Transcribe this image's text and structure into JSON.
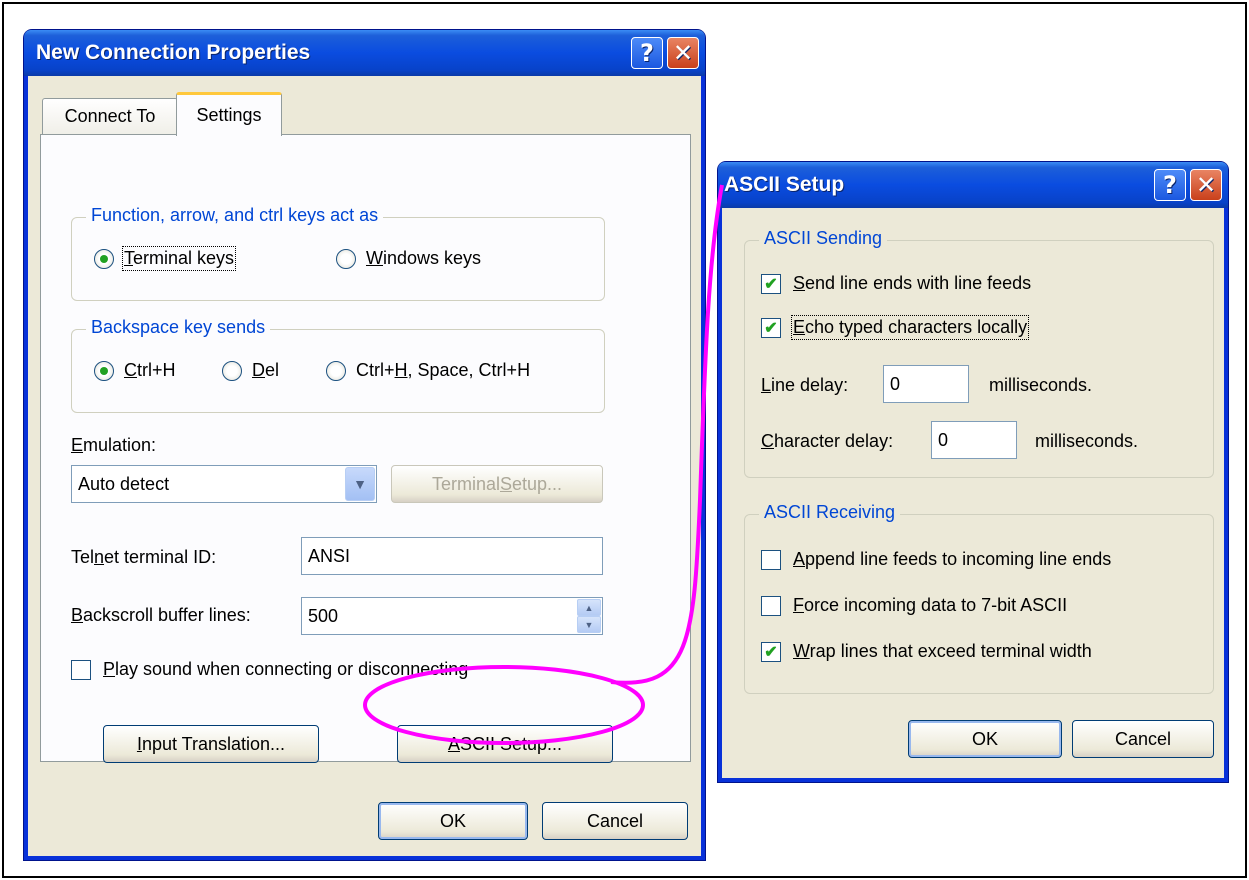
{
  "main_dialog": {
    "title": "New Connection Properties",
    "tabs": [
      {
        "label": "Connect To"
      },
      {
        "label": "Settings"
      }
    ],
    "function_keys_group": {
      "legend": "Function, arrow, and ctrl keys act as",
      "options": [
        {
          "pre": "",
          "mnemonic": "T",
          "post": "erminal keys",
          "selected": true
        },
        {
          "pre": "",
          "mnemonic": "W",
          "post": "indows keys",
          "selected": false
        }
      ]
    },
    "backspace_group": {
      "legend": "Backspace key sends",
      "options": [
        {
          "pre": "",
          "mnemonic": "C",
          "post": "trl+H",
          "selected": true
        },
        {
          "pre": "",
          "mnemonic": "D",
          "post": "el",
          "selected": false
        },
        {
          "pre": "Ctrl+",
          "mnemonic": "H",
          "post": ", Space, Ctrl+H",
          "selected": false
        }
      ]
    },
    "emulation": {
      "label_pre": "",
      "label_mnemonic": "E",
      "label_post": "mulation:",
      "value": "Auto detect"
    },
    "terminal_setup_button": {
      "pre": "Terminal ",
      "mnemonic": "S",
      "post": "etup..."
    },
    "telnet_id": {
      "label_pre": "Tel",
      "label_mnemonic": "n",
      "label_post": "et terminal ID:",
      "value": "ANSI"
    },
    "backscroll": {
      "label_pre": "",
      "label_mnemonic": "B",
      "label_post": "ackscroll buffer lines:",
      "value": "500"
    },
    "play_sound": {
      "pre": "",
      "mnemonic": "P",
      "post": "lay sound when connecting or disconnecting",
      "checked": false
    },
    "input_translation_button": {
      "pre": "",
      "mnemonic": "I",
      "post": "nput Translation..."
    },
    "ascii_setup_button": {
      "pre": "",
      "mnemonic": "A",
      "post": "SCII Setup..."
    },
    "ok_label": "OK",
    "cancel_label": "Cancel"
  },
  "ascii_dialog": {
    "title": "ASCII Setup",
    "sending": {
      "legend": "ASCII Sending",
      "send_line_ends": {
        "pre": "",
        "mnemonic": "S",
        "post": "end line ends with line feeds",
        "checked": true
      },
      "echo_typed": {
        "pre": "",
        "mnemonic": "E",
        "post": "cho typed characters locally",
        "checked": true
      },
      "line_delay": {
        "label_pre": "",
        "label_mnemonic": "L",
        "label_post": "ine delay:",
        "value": "0",
        "unit": "milliseconds."
      },
      "char_delay": {
        "label_pre": "",
        "label_mnemonic": "C",
        "label_post": "haracter delay:",
        "value": "0",
        "unit": "milliseconds."
      }
    },
    "receiving": {
      "legend": "ASCII Receiving",
      "append_line_feeds": {
        "pre": "",
        "mnemonic": "A",
        "post": "ppend line feeds to incoming line ends",
        "checked": false
      },
      "force_7bit": {
        "pre": "",
        "mnemonic": "F",
        "post": "orce incoming data to 7-bit ASCII",
        "checked": false
      },
      "wrap_lines": {
        "pre": "",
        "mnemonic": "W",
        "post": "rap lines that exceed terminal width",
        "checked": true
      }
    },
    "ok_label": "OK",
    "cancel_label": "Cancel"
  },
  "icons": {
    "help": "?",
    "close": "✕",
    "checkmark": "✔",
    "dropdown": "▼",
    "spin_up": "▲",
    "spin_down": "▼"
  },
  "colors": {
    "titlebar": "#0a4ce0",
    "group_legend": "#0046d5",
    "annotation": "#ff00ff",
    "face": "#ece9d8"
  }
}
